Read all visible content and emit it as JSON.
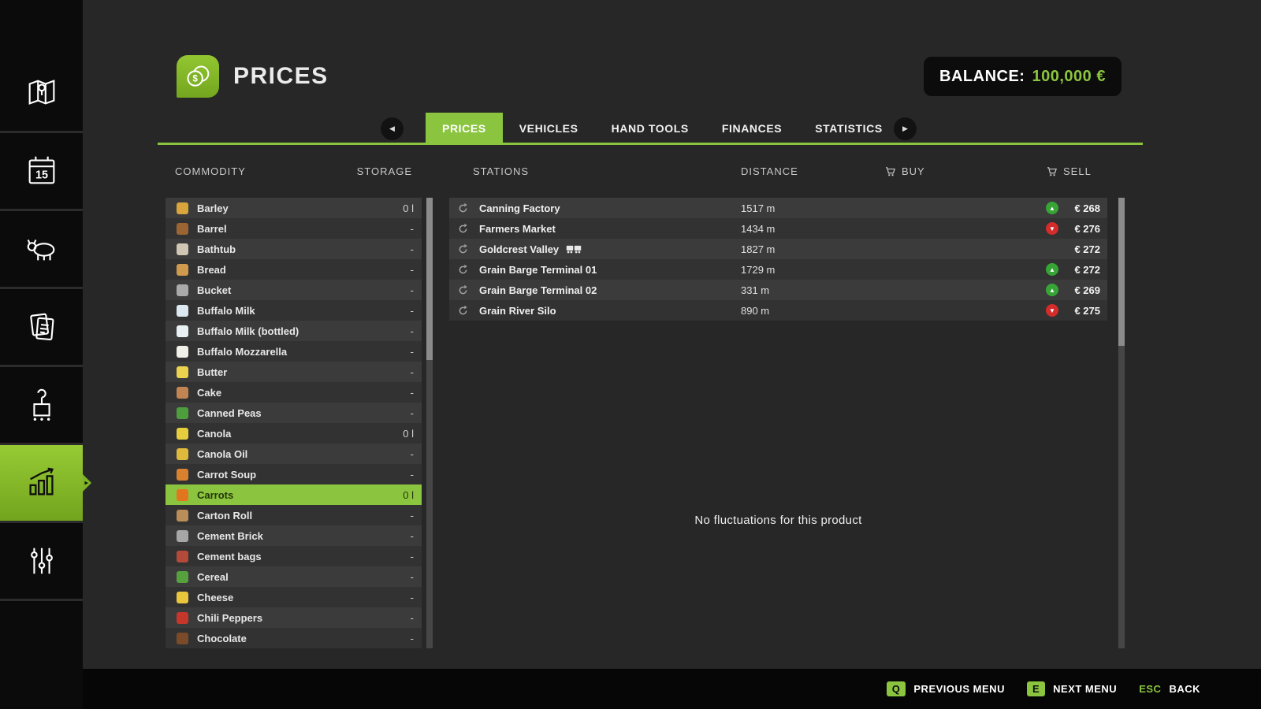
{
  "colors": {
    "accent": "#8bc53f",
    "trend_up": "#36a536",
    "trend_down": "#d42b2b",
    "balance_value": "#8bc53f"
  },
  "icons": {
    "prev": "◀",
    "next": "▶",
    "trend_up": "▲",
    "trend_down": "▼",
    "active_notch": "▸"
  },
  "sidebar": {
    "calendar_day": "15",
    "items": [
      "map",
      "calendar",
      "animals",
      "contracts",
      "production",
      "prices",
      "settings"
    ],
    "active_item": "prices"
  },
  "header": {
    "title": "PRICES",
    "balance_label": "BALANCE:",
    "balance_value": "100,000 €"
  },
  "tabs": [
    {
      "label": "PRICES",
      "active": true
    },
    {
      "label": "VEHICLES",
      "active": false
    },
    {
      "label": "HAND TOOLS",
      "active": false
    },
    {
      "label": "FINANCES",
      "active": false
    },
    {
      "label": "STATISTICS",
      "active": false
    }
  ],
  "columns": {
    "commodity": "COMMODITY",
    "storage": "STORAGE",
    "stations": "STATIONS",
    "distance": "DISTANCE",
    "buy": "BUY",
    "sell": "SELL"
  },
  "commodities": [
    {
      "name": "Barley",
      "storage": "0 l",
      "color": "#d9a43b",
      "selected": false
    },
    {
      "name": "Barrel",
      "storage": "-",
      "color": "#9a6533",
      "selected": false
    },
    {
      "name": "Bathtub",
      "storage": "-",
      "color": "#cfc6b4",
      "selected": false
    },
    {
      "name": "Bread",
      "storage": "-",
      "color": "#cf9a4e",
      "selected": false
    },
    {
      "name": "Bucket",
      "storage": "-",
      "color": "#a9a9a9",
      "selected": false
    },
    {
      "name": "Buffalo Milk",
      "storage": "-",
      "color": "#dce8f0",
      "selected": false
    },
    {
      "name": "Buffalo Milk (bottled)",
      "storage": "-",
      "color": "#e9f0f4",
      "selected": false
    },
    {
      "name": "Buffalo Mozzarella",
      "storage": "-",
      "color": "#f0f0e8",
      "selected": false
    },
    {
      "name": "Butter",
      "storage": "-",
      "color": "#ecd34f",
      "selected": false
    },
    {
      "name": "Cake",
      "storage": "-",
      "color": "#c08552",
      "selected": false
    },
    {
      "name": "Canned Peas",
      "storage": "-",
      "color": "#4e9e3e",
      "selected": false
    },
    {
      "name": "Canola",
      "storage": "0 l",
      "color": "#e6cd3e",
      "selected": false
    },
    {
      "name": "Canola Oil",
      "storage": "-",
      "color": "#dfb93c",
      "selected": false
    },
    {
      "name": "Carrot Soup",
      "storage": "-",
      "color": "#d8822f",
      "selected": false
    },
    {
      "name": "Carrots",
      "storage": "0 l",
      "color": "#e2761f",
      "selected": true
    },
    {
      "name": "Carton Roll",
      "storage": "-",
      "color": "#b98e58",
      "selected": false
    },
    {
      "name": "Cement Brick",
      "storage": "-",
      "color": "#a6a6a6",
      "selected": false
    },
    {
      "name": "Cement bags",
      "storage": "-",
      "color": "#b34a3a",
      "selected": false
    },
    {
      "name": "Cereal",
      "storage": "-",
      "color": "#57a03e",
      "selected": false
    },
    {
      "name": "Cheese",
      "storage": "-",
      "color": "#eac63d",
      "selected": false
    },
    {
      "name": "Chili Peppers",
      "storage": "-",
      "color": "#c5372a",
      "selected": false
    },
    {
      "name": "Chocolate",
      "storage": "-",
      "color": "#7b4a28",
      "selected": false
    }
  ],
  "stations": [
    {
      "name": "Canning Factory",
      "distance": "1517 m",
      "sell": "€ 268",
      "trend": "up",
      "train": false
    },
    {
      "name": "Farmers Market",
      "distance": "1434 m",
      "sell": "€ 276",
      "trend": "down",
      "train": false
    },
    {
      "name": "Goldcrest Valley",
      "distance": "1827 m",
      "sell": "€ 272",
      "trend": "none",
      "train": true
    },
    {
      "name": "Grain Barge Terminal 01",
      "distance": "1729 m",
      "sell": "€ 272",
      "trend": "up",
      "train": false
    },
    {
      "name": "Grain Barge Terminal 02",
      "distance": "331 m",
      "sell": "€ 269",
      "trend": "up",
      "train": false
    },
    {
      "name": "Grain River Silo",
      "distance": "890 m",
      "sell": "€ 275",
      "trend": "down",
      "train": false
    }
  ],
  "stations_panel": {
    "empty_message": "No fluctuations for this product"
  },
  "footer_hints": [
    {
      "key": "Q",
      "label": "PREVIOUS MENU"
    },
    {
      "key": "E",
      "label": "NEXT MENU"
    },
    {
      "key": "ESC",
      "label": "BACK"
    }
  ]
}
